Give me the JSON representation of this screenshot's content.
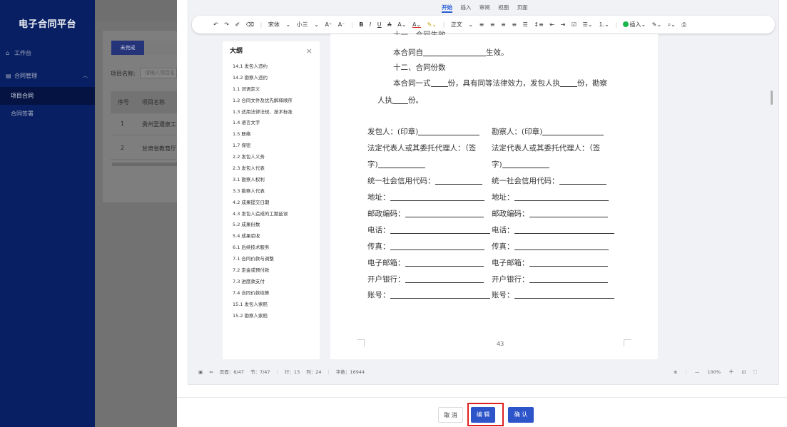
{
  "app": {
    "brand": "电子合同平台",
    "nav": [
      {
        "label": "工作台",
        "icon": "home-icon"
      },
      {
        "label": "合同管理",
        "icon": "document-icon",
        "expanded": true
      }
    ],
    "subnav": [
      {
        "label": "项目合同",
        "active": true
      },
      {
        "label": "合同签署",
        "active": false
      }
    ],
    "tabs": {
      "active": "未完成"
    },
    "search": {
      "label": "项目名称:",
      "placeholder": "请输入项目名"
    },
    "table": {
      "headers": [
        "序号",
        "项目名称"
      ],
      "rows": [
        {
          "index": "1",
          "name": "贵州至遵泉工"
        },
        {
          "index": "2",
          "name": "甘肃省教育厅"
        }
      ]
    }
  },
  "editor": {
    "menu_tabs": [
      {
        "label": "开始",
        "active": true
      },
      {
        "label": "插入",
        "active": false
      },
      {
        "label": "审阅",
        "active": false
      },
      {
        "label": "视图",
        "active": false
      },
      {
        "label": "页面",
        "active": false
      }
    ],
    "toolbar": {
      "font_family": "宋体",
      "font_size": "小三",
      "paragraph_style": "正文",
      "insert_label": "插入"
    },
    "outline": {
      "title": "大纲",
      "items": [
        "14.1 发包人违约",
        "14.2 勘察人违约",
        "1.1 词语定义",
        "1.2 合同文件及优先解释顺序",
        "1.3 适用法律法规、技术标准",
        "1.4 语言文字",
        "1.5 联络",
        "1.7 保密",
        "2.2 发包人义务",
        "2.3 发包人代表",
        "3.1 勘察人权利",
        "3.3 勘察人代表",
        "4.2 成果提交日期",
        "4.3 发包人造成的工期延误",
        "5.2 成果份数",
        "5.4 成果验收",
        "6.1 后续技术服务",
        "7.1 合同价款与调整",
        "7.2 定金或预付款",
        "7.3 进度款支付",
        "7.4 合同价款结算",
        "15.1 发包人索赔",
        "15.2 勘察人索赔"
      ]
    },
    "document": {
      "partial_heading": "十一、合同生效",
      "effective_prefix": "本合同自",
      "effective_suffix": "生效。",
      "copies_heading": "十二、合同份数",
      "copies_text_1": "本合同一式",
      "copies_text_2": "份，具有同等法律效力，发包人执",
      "copies_text_3": "份，勘察",
      "copies_text_4": "人执",
      "copies_text_5": "份。",
      "left_fields": {
        "party": "发包人：(印章)",
        "rep_1": "法定代表人或其委托代理人：（签",
        "rep_2": "字)",
        "credit_code": "统一社会信用代码：",
        "address": "地址：",
        "postcode": "邮政编码：",
        "phone": "电话：",
        "fax": "传真：",
        "email": "电子邮箱：",
        "bank": "开户银行：",
        "account": "账号："
      },
      "right_fields": {
        "party": "勘察人：(印章)",
        "rep_1": "法定代表人或其委托代理人：（签",
        "rep_2": "字)",
        "credit_code": "统一社会信用代码：",
        "address": "地址：",
        "postcode": "邮政编码：",
        "phone": "电话：",
        "fax": "传真：",
        "email": "电子邮箱：",
        "bank": "开户银行：",
        "account": "账号："
      },
      "page_number": "43"
    },
    "status": {
      "page": "页面：8/47",
      "section": "节：7/47",
      "row": "行：13",
      "col": "列：24",
      "word_count": "字数：16944",
      "zoom": "100%",
      "zoom_minus": "—",
      "zoom_plus": "+"
    }
  },
  "footer": {
    "cancel_label": "取 消",
    "edit_label": "编 辑",
    "confirm_label": "确 认"
  },
  "colors": {
    "primary": "#2d55c9",
    "sidebar": "#081f63",
    "highlight": "#e02020"
  }
}
